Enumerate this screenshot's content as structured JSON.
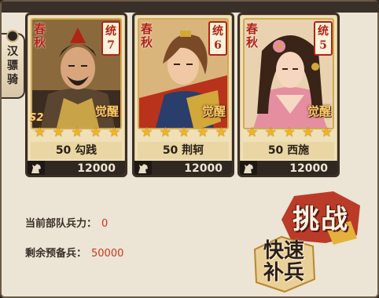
{
  "side_tab": {
    "label_chars": [
      "汉",
      "骠",
      "骑"
    ]
  },
  "cards": [
    {
      "era": "春秋",
      "lead_label": "统",
      "lead_value": "7",
      "awaken": "觉醒",
      "skill_badge": "S2",
      "stars": 5,
      "level_name": "50 勾践",
      "troops": "12000"
    },
    {
      "era": "春秋",
      "lead_label": "统",
      "lead_value": "6",
      "awaken": "觉醒",
      "skill_badge": "",
      "stars": 5,
      "level_name": "50 荆轲",
      "troops": "12000"
    },
    {
      "era": "春秋",
      "lead_label": "统",
      "lead_value": "5",
      "awaken": "觉醒",
      "skill_badge": "",
      "stars": 5,
      "level_name": "50 西施",
      "troops": "12000"
    }
  ],
  "info": {
    "current_troops_label": "当前部队兵力：",
    "current_troops_value": "0",
    "reserve_label": "剩余预备兵：",
    "reserve_value": "50000"
  },
  "buttons": {
    "challenge": "挑战",
    "refill_line1": "快速",
    "refill_line2": "补兵"
  },
  "colors": {
    "accent_red": "#b02416",
    "gold": "#f2b51c",
    "panel_bg": "#ece4d4"
  }
}
